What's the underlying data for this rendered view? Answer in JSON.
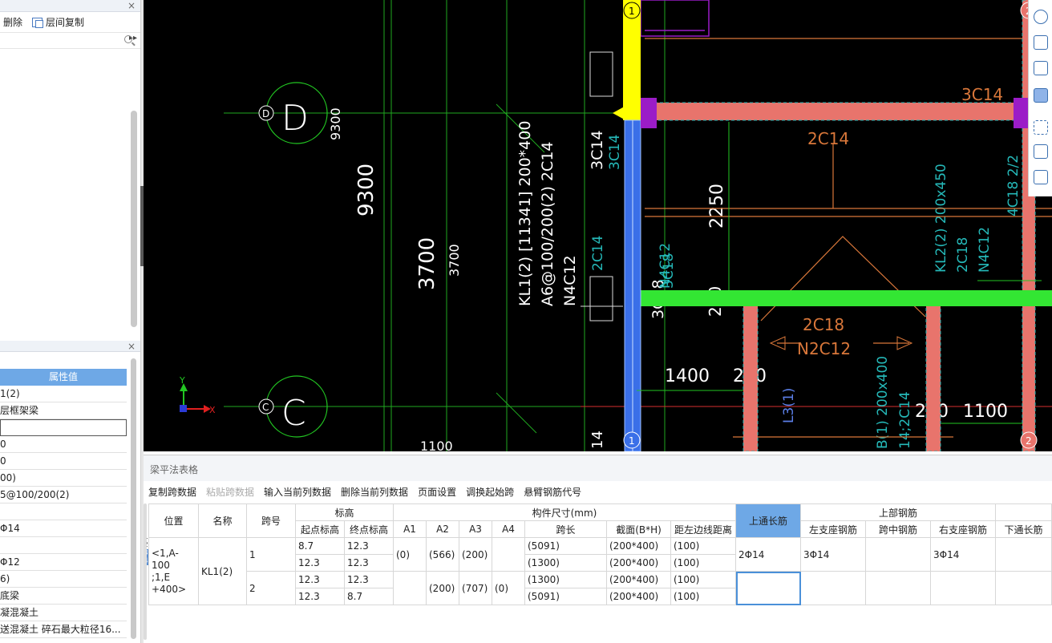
{
  "left_top": {
    "toolbar": {
      "delete_label": "删除",
      "floor_copy_label": "层间复制",
      "more": "▸▸"
    },
    "close": "×"
  },
  "left_bottom": {
    "close": "×",
    "header": "属性值",
    "rows": [
      "1(2)",
      "层框架梁",
      "",
      "0",
      "0",
      "00)",
      "5@100/200(2)",
      "",
      "Φ14",
      "",
      "Φ12",
      "6)",
      "底梁",
      "凝混凝土",
      "送混凝土 碎石最大粒径16..."
    ]
  },
  "cad": {
    "axis_labels": {
      "d": "D",
      "c": "C",
      "one": "1",
      "two": "2",
      "y": "Y",
      "x": "X"
    },
    "dims": [
      "9300",
      "9300",
      "3700",
      "3700",
      "1100",
      "2250",
      "1400",
      "200",
      "200",
      "1100",
      "200",
      "14",
      "14"
    ],
    "beam_text": [
      "KL1(2) [11341] 200*400",
      "A6@100/200(2) 2C14",
      "N4C12",
      "3C14",
      "3C14",
      "3C18",
      "3C18",
      "N4C12",
      "2C14",
      "3C14",
      "2C14",
      "2C18",
      "N2C12",
      "KL2(2) 200x450",
      "2C18",
      "N4C12",
      "4C18 2/2",
      "B(1) 200x400",
      "14;2C14",
      "L3(1)"
    ],
    "colors": {
      "pink": "#e8746c",
      "green": "#33e633",
      "yellow": "#ffff00",
      "blue": "#3a6fe8",
      "purple": "#9b1cc7",
      "orange": "#d9773a",
      "cyan": "#25b9b9"
    }
  },
  "bottom": {
    "title": "梁平法表格",
    "tools": [
      "复制跨数据",
      "粘贴跨数据",
      "输入当前列数据",
      "删除当前列数据",
      "页面设置",
      "调换起始跨",
      "悬臂钢筋代号"
    ],
    "table": {
      "h_pos": "位置",
      "h_name": "名称",
      "h_span": "跨号",
      "h_elev": "标高",
      "h_start": "起点标高",
      "h_end": "终点标高",
      "h_size": "构件尺寸(mm)",
      "h_a1": "A1",
      "h_a2": "A2",
      "h_a3": "A3",
      "h_a4": "A4",
      "h_len": "跨长",
      "h_sec": "截面(B*H)",
      "h_dist": "距左边线距离",
      "h_top_cont": "上通长筋",
      "h_top": "上部钢筋",
      "h_left_sup": "左支座钢筋",
      "h_mid": "跨中钢筋",
      "h_right_sup": "右支座钢筋",
      "h_bot_cont": "下通长筋",
      "pos_value": "<1,A-100\n;1,E\n+400>",
      "name_value": "KL1(2)",
      "span1": "1",
      "span2": "2",
      "r1": {
        "start": "8.7",
        "end": "12.3",
        "len": "(5091)",
        "sec": "(200*400)",
        "dist": "(100)"
      },
      "r2": {
        "start": "12.3",
        "end": "12.3",
        "len": "(1300)",
        "sec": "(200*400)",
        "dist": "(100)"
      },
      "r3": {
        "start": "12.3",
        "end": "12.3",
        "len": "(1300)",
        "sec": "(200*400)",
        "dist": "(100)"
      },
      "r4": {
        "start": "12.3",
        "end": "8.7",
        "len": "(5091)",
        "sec": "(200*400)",
        "dist": "(100)"
      },
      "s1": {
        "a1": "(0)",
        "a2": "(566)",
        "a3": "(200)",
        "a4": "",
        "top_cont": "2Φ14",
        "left_sup": "3Φ14",
        "mid": "",
        "right_sup": "3Φ14"
      },
      "s2": {
        "a1": "",
        "a2": "(200)",
        "a3": "(707)",
        "a4": "(0)"
      }
    }
  }
}
